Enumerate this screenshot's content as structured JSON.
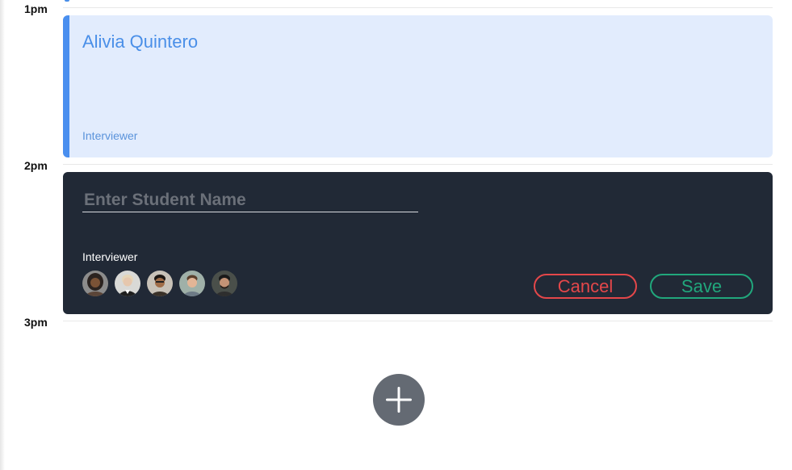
{
  "timeline": {
    "labels": [
      "1pm",
      "2pm",
      "3pm"
    ]
  },
  "event": {
    "name": "Alivia Quintero",
    "role": "Interviewer",
    "accent_color": "#4a8fef",
    "background_color": "#e2ecfd"
  },
  "editor": {
    "placeholder": "Enter Student Name",
    "value": "",
    "role_label": "Interviewer",
    "interviewer_avatars": [
      "avatar-1",
      "avatar-2",
      "avatar-3",
      "avatar-4",
      "avatar-5"
    ],
    "cancel_label": "Cancel",
    "save_label": "Save",
    "cancel_color": "#e4474a",
    "save_color": "#21a77c",
    "background_color": "#212936"
  },
  "add_button": {
    "icon": "plus-icon"
  }
}
